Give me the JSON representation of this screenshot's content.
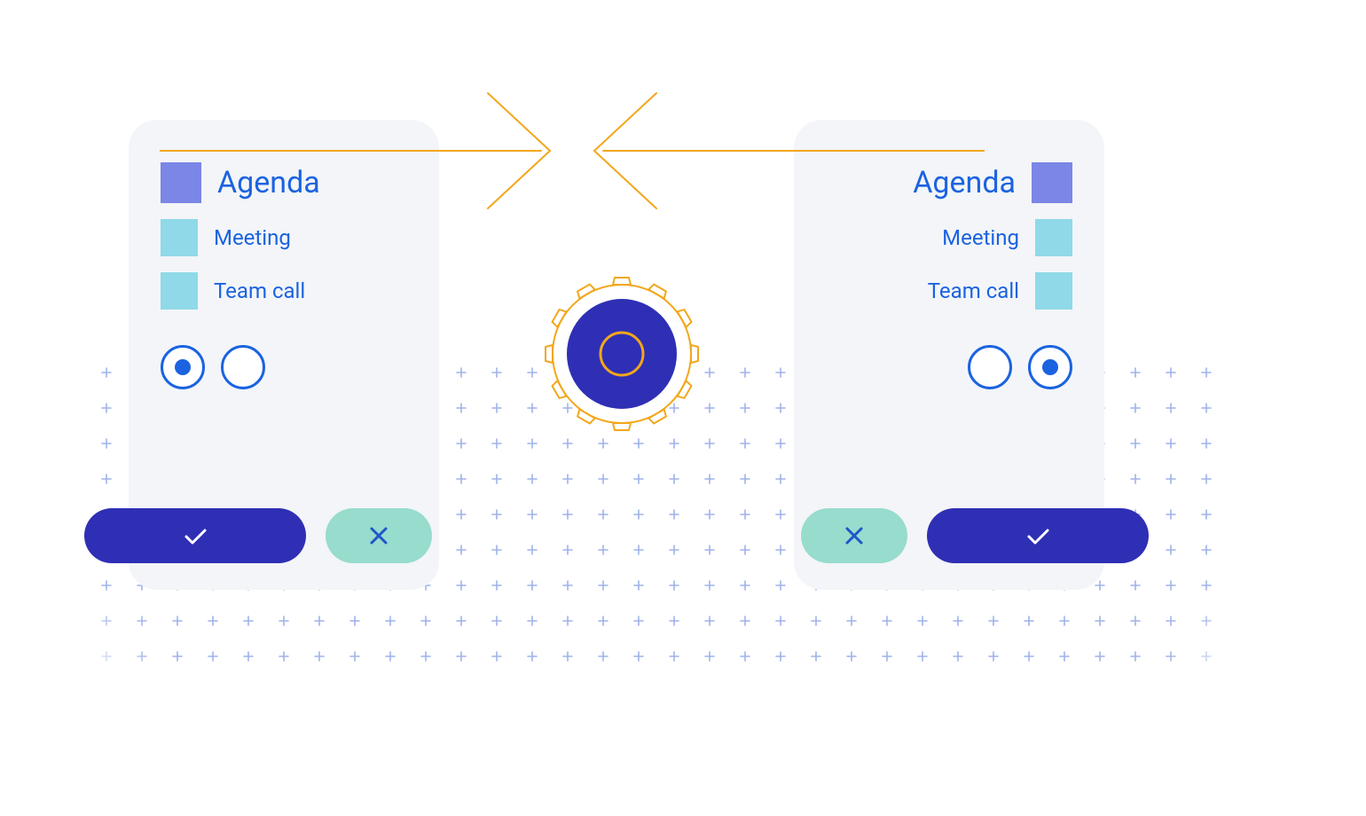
{
  "colors": {
    "blue_text": "#1b63e0",
    "indigo": "#2f2fb5",
    "purple_swatch": "#7b86e6",
    "cyan_swatch": "#8fd9e8",
    "mint": "#97dccd",
    "gold": "#f2a71b",
    "card_bg": "#f3f5f8",
    "plus_mark": "#9fb2ea"
  },
  "left_card": {
    "title": "Agenda",
    "items": [
      "Meeting",
      "Team call"
    ],
    "radio_selected_index": 0,
    "confirm_icon": "check-icon",
    "cancel_icon": "x-icon"
  },
  "right_card": {
    "title": "Agenda",
    "items": [
      "Meeting",
      "Team call"
    ],
    "radio_selected_index": 1,
    "confirm_icon": "check-icon",
    "cancel_icon": "x-icon"
  },
  "center": {
    "icon": "gear-icon"
  }
}
